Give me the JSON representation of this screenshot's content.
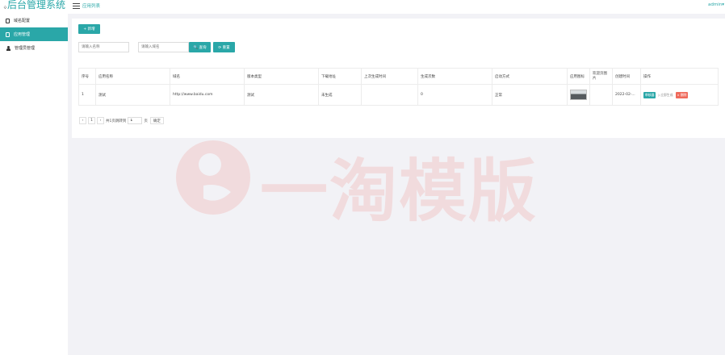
{
  "header": {
    "app_title": "后台管理系统",
    "breadcrumb": "应用列表",
    "user": "admin"
  },
  "sidebar": {
    "items": [
      {
        "label": "域名配置",
        "icon": "document-icon"
      },
      {
        "label": "应用管理",
        "icon": "document-icon",
        "active": true
      },
      {
        "label": "管理员管理",
        "icon": "user-icon"
      }
    ]
  },
  "toolbar": {
    "add_label": "+ 新增"
  },
  "search": {
    "name_placeholder": "请输入名称",
    "domain_placeholder": "请输入域名",
    "query_label": "🔍 查询",
    "reset_label": "⟳ 重置"
  },
  "table": {
    "columns": [
      "序号",
      "应用名称",
      "域名",
      "版本类型",
      "下载地址",
      "上次生成时间",
      "生成次数",
      "启动方式",
      "应用图标",
      "欢迎页图片",
      "创建时间",
      "操作"
    ],
    "rows": [
      {
        "index": "1",
        "name": "测试",
        "domain": "http://www.baidu.com",
        "version_type": "测试",
        "download": "未生成",
        "last_generated": "",
        "count": "0",
        "launch_mode": "正常",
        "welcome_image": "",
        "created": "2022-02-...",
        "actions": {
          "edit": "审核器",
          "generate": "▷立即生成",
          "delete": "× 删除"
        }
      }
    ]
  },
  "pagination": {
    "prev": "‹",
    "page": "1",
    "next": "›",
    "summary": "共1页跳转到",
    "goto_value": "1",
    "page_unit": "页",
    "confirm": "确定"
  },
  "watermark": {
    "text": "一淘模版"
  },
  "colors": {
    "accent": "#2aa7a8",
    "danger": "#ef6a5b",
    "watermark": "#ef4a3a"
  }
}
